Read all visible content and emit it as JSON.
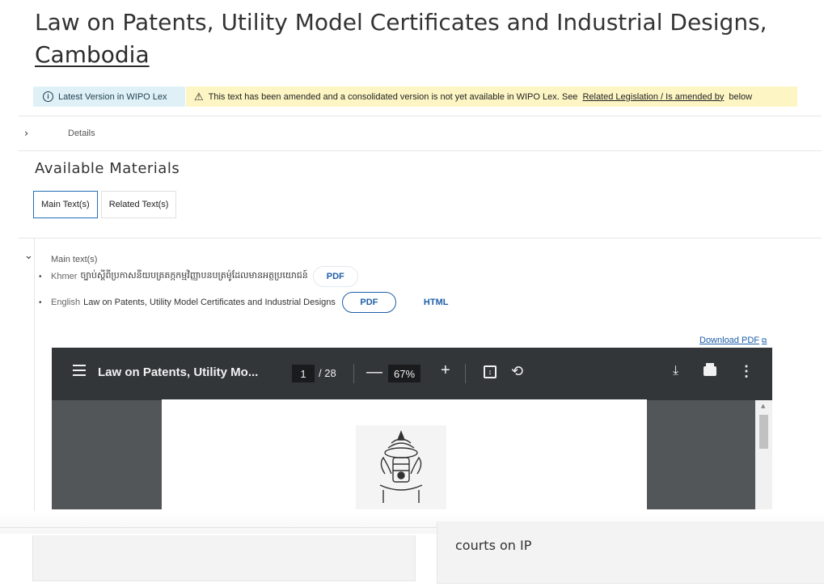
{
  "page": {
    "title_main": "Law on Patents, Utility Model Certificates and Industrial Designs,",
    "title_country": "Cambodia"
  },
  "banners": {
    "latest": "Latest Version in WIPO Lex",
    "amended_text": "This text has been amended and a consolidated version is not yet available in WIPO Lex. See",
    "amended_link": "Related Legislation / Is amended by",
    "amended_suffix": "below"
  },
  "details": {
    "label": "Details"
  },
  "materials": {
    "title": "Available Materials",
    "tabs": [
      {
        "label": "Main Text(s)",
        "active": true
      },
      {
        "label": "Related Text(s)",
        "active": false
      }
    ],
    "section_label": "Main text(s)",
    "documents": [
      {
        "lang": "Khmer",
        "title": "ច្បាប់ស្ដីពីប្រកាសនីយបត្រតក្កកម្មវិញ្ញាបនបត្រម៉ូដែលមានអត្ថប្រយោជន៍",
        "pdf_label": "PDF"
      },
      {
        "lang": "English",
        "title": "Law on Patents, Utility Model Certificates and Industrial Designs",
        "pdf_label": "PDF",
        "html_label": "HTML"
      }
    ],
    "download_pdf": "Download PDF"
  },
  "viewer": {
    "doc_title": "Law on Patents, Utility Mo...",
    "page_current": "1",
    "page_total": "/ 28",
    "zoom": "67%"
  },
  "bottom_cards": {
    "right_text": "courts on IP"
  },
  "colors": {
    "link": "#1f5fa8",
    "info_bg": "#dff1f7",
    "warn_bg": "#fdf6c4",
    "toolbar": "#323639"
  },
  "icons": [
    "info-icon",
    "warning-icon",
    "chevron-right-icon",
    "chevron-down-icon",
    "external-link-icon",
    "menu-icon",
    "download-icon",
    "print-icon",
    "more-icon",
    "fit-page-icon",
    "rotate-icon",
    "emblem-image"
  ]
}
